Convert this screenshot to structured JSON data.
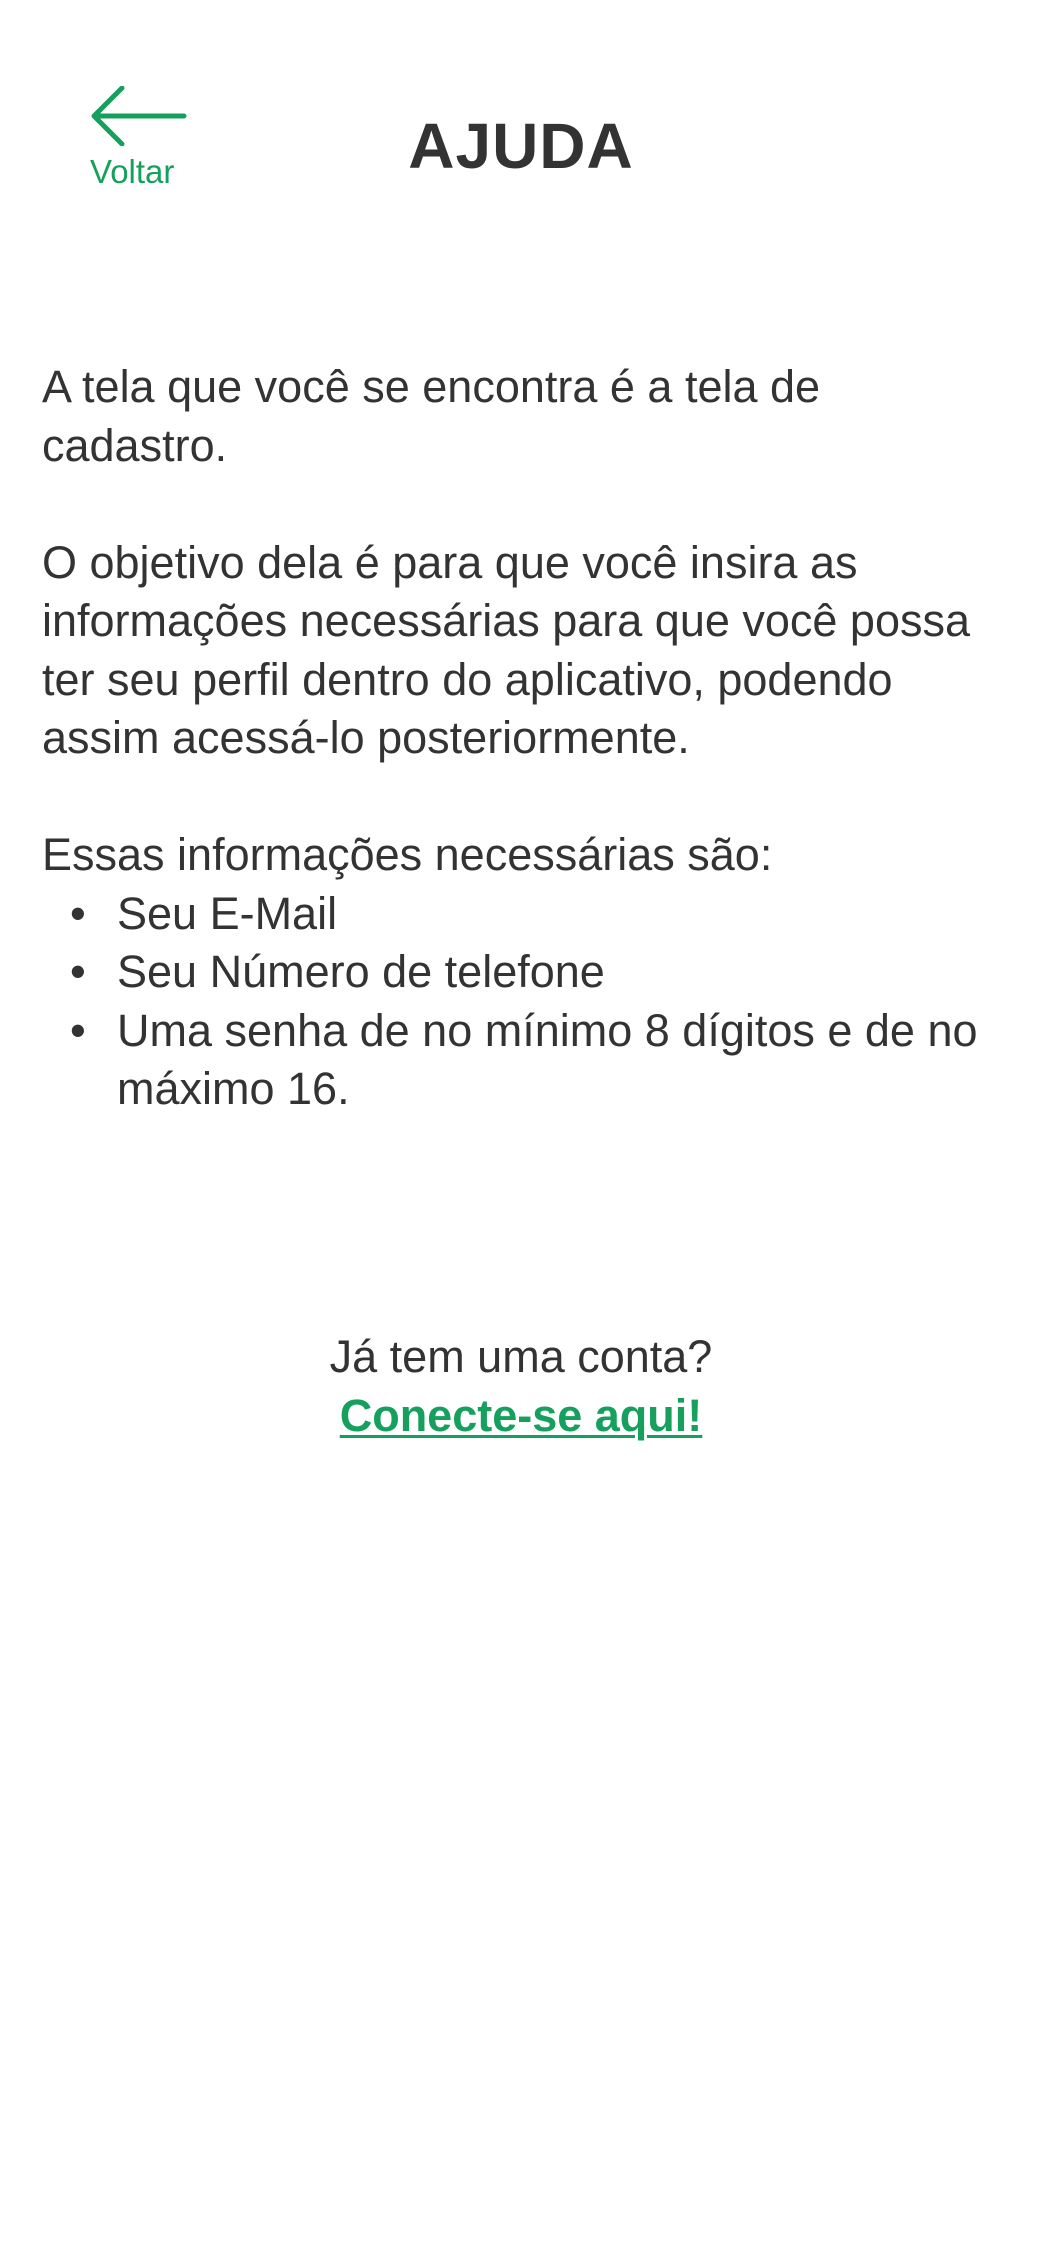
{
  "header": {
    "back_label": "Voltar",
    "title": "AJUDA"
  },
  "help": {
    "paragraph1": "A tela que você se encontra é a tela de cadastro.",
    "paragraph2": "O objetivo dela é para que você insira as informações necessárias para que você possa ter seu perfil dentro do aplicativo, podendo assim acessá-lo posteriormente.",
    "list_intro": "Essas informações necessárias são:",
    "items": [
      "Seu E-Mail",
      "Seu Número de telefone",
      "Uma senha de no mínimo 8 dígitos e de no máximo 16."
    ]
  },
  "footer": {
    "question": "Já tem uma conta?",
    "link": "Conecte-se aqui!"
  },
  "colors": {
    "accent": "#16a05d",
    "text": "#333333",
    "background": "#ffffff"
  },
  "icons": {
    "back": "arrow-left-icon"
  }
}
